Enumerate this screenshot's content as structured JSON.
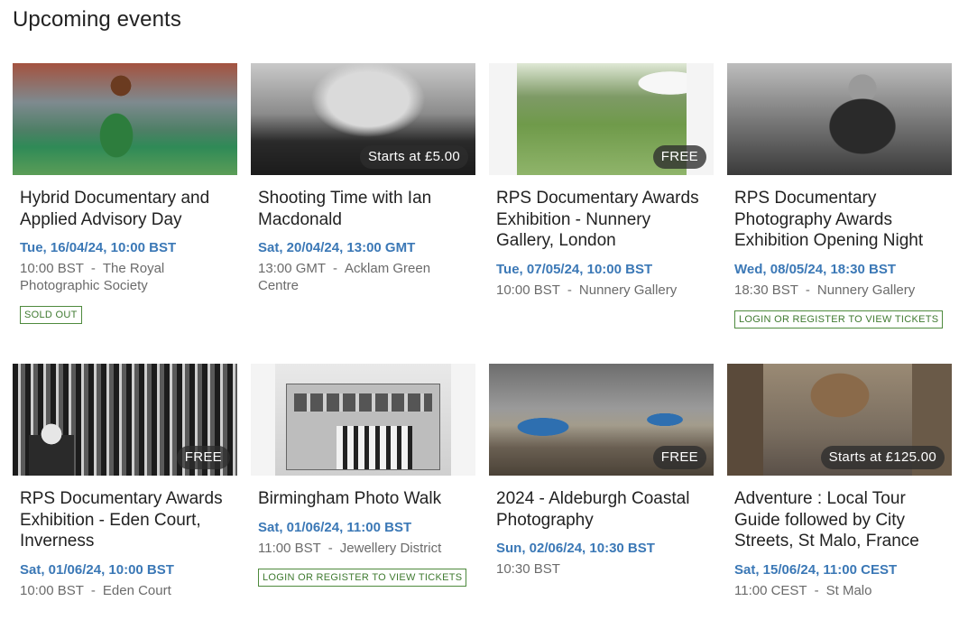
{
  "page": {
    "title": "Upcoming events"
  },
  "colors": {
    "date_blue": "#3b78b6",
    "tag_green": "#3f7a30",
    "meta_gray": "#6b6b6b"
  },
  "events": [
    {
      "name": "Hybrid Documentary and Applied Advisory Day",
      "date": "Tue, 16/04/24, 10:00 BST",
      "time": "10:00 BST",
      "location": "The Royal Photographic Society",
      "price": "",
      "tag": "SOLD OUT",
      "image": "rugby-player-photo"
    },
    {
      "name": "Shooting Time with Ian Macdonald",
      "date": "Sat, 20/04/24, 13:00 GMT",
      "time": "13:00 GMT",
      "location": "Acklam Green Centre",
      "price": "Starts at £5.00",
      "tag": "",
      "image": "industrial-smoke-photo"
    },
    {
      "name": "RPS Documentary Awards Exhibition - Nunnery Gallery, London",
      "date": "Tue, 07/05/24, 10:00 BST",
      "time": "10:00 BST",
      "location": "Nunnery Gallery",
      "price": "FREE",
      "tag": "",
      "image": "field-performers-photo"
    },
    {
      "name": "RPS Documentary Photography Awards Exhibition Opening Night",
      "date": "Wed, 08/05/24, 18:30 BST",
      "time": "18:30 BST",
      "location": "Nunnery Gallery",
      "price": "",
      "tag": "LOGIN OR REGISTER TO VIEW TICKETS",
      "image": "bw-portrait-photo"
    },
    {
      "name": "RPS Documentary Awards Exhibition - Eden Court, Inverness",
      "date": "Sat, 01/06/24, 10:00 BST",
      "time": "10:00 BST",
      "location": "Eden Court",
      "price": "FREE",
      "tag": "",
      "image": "mural-portrait-photo"
    },
    {
      "name": "Birmingham Photo Walk",
      "date": "Sat, 01/06/24, 11:00 BST",
      "time": "11:00 BST",
      "location": "Jewellery District",
      "price": "",
      "tag": "LOGIN OR REGISTER TO VIEW TICKETS",
      "image": "building-facade-photo"
    },
    {
      "name": "2024 - Aldeburgh Coastal Photography",
      "date": "Sun, 02/06/24, 10:30 BST",
      "time": "10:30 BST",
      "location": "",
      "price": "FREE",
      "tag": "",
      "image": "beach-boats-photo"
    },
    {
      "name": "Adventure : Local Tour Guide followed by City Streets, St Malo, France",
      "date": "Sat, 15/06/24, 11:00 CEST",
      "time": "11:00 CEST",
      "location": "St Malo",
      "price": "Starts at £125.00",
      "tag": "",
      "image": "old-street-photo"
    }
  ]
}
